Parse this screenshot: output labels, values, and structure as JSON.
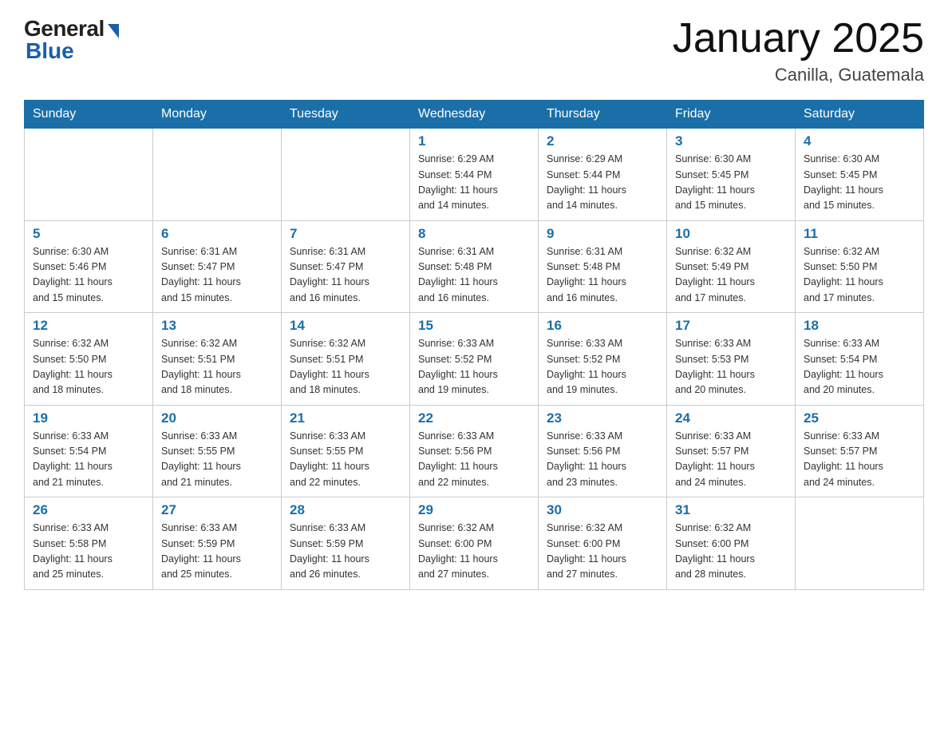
{
  "header": {
    "logo_general": "General",
    "logo_blue": "Blue",
    "month_title": "January 2025",
    "location": "Canilla, Guatemala"
  },
  "weekdays": [
    "Sunday",
    "Monday",
    "Tuesday",
    "Wednesday",
    "Thursday",
    "Friday",
    "Saturday"
  ],
  "weeks": [
    [
      {
        "day": "",
        "info": ""
      },
      {
        "day": "",
        "info": ""
      },
      {
        "day": "",
        "info": ""
      },
      {
        "day": "1",
        "info": "Sunrise: 6:29 AM\nSunset: 5:44 PM\nDaylight: 11 hours\nand 14 minutes."
      },
      {
        "day": "2",
        "info": "Sunrise: 6:29 AM\nSunset: 5:44 PM\nDaylight: 11 hours\nand 14 minutes."
      },
      {
        "day": "3",
        "info": "Sunrise: 6:30 AM\nSunset: 5:45 PM\nDaylight: 11 hours\nand 15 minutes."
      },
      {
        "day": "4",
        "info": "Sunrise: 6:30 AM\nSunset: 5:45 PM\nDaylight: 11 hours\nand 15 minutes."
      }
    ],
    [
      {
        "day": "5",
        "info": "Sunrise: 6:30 AM\nSunset: 5:46 PM\nDaylight: 11 hours\nand 15 minutes."
      },
      {
        "day": "6",
        "info": "Sunrise: 6:31 AM\nSunset: 5:47 PM\nDaylight: 11 hours\nand 15 minutes."
      },
      {
        "day": "7",
        "info": "Sunrise: 6:31 AM\nSunset: 5:47 PM\nDaylight: 11 hours\nand 16 minutes."
      },
      {
        "day": "8",
        "info": "Sunrise: 6:31 AM\nSunset: 5:48 PM\nDaylight: 11 hours\nand 16 minutes."
      },
      {
        "day": "9",
        "info": "Sunrise: 6:31 AM\nSunset: 5:48 PM\nDaylight: 11 hours\nand 16 minutes."
      },
      {
        "day": "10",
        "info": "Sunrise: 6:32 AM\nSunset: 5:49 PM\nDaylight: 11 hours\nand 17 minutes."
      },
      {
        "day": "11",
        "info": "Sunrise: 6:32 AM\nSunset: 5:50 PM\nDaylight: 11 hours\nand 17 minutes."
      }
    ],
    [
      {
        "day": "12",
        "info": "Sunrise: 6:32 AM\nSunset: 5:50 PM\nDaylight: 11 hours\nand 18 minutes."
      },
      {
        "day": "13",
        "info": "Sunrise: 6:32 AM\nSunset: 5:51 PM\nDaylight: 11 hours\nand 18 minutes."
      },
      {
        "day": "14",
        "info": "Sunrise: 6:32 AM\nSunset: 5:51 PM\nDaylight: 11 hours\nand 18 minutes."
      },
      {
        "day": "15",
        "info": "Sunrise: 6:33 AM\nSunset: 5:52 PM\nDaylight: 11 hours\nand 19 minutes."
      },
      {
        "day": "16",
        "info": "Sunrise: 6:33 AM\nSunset: 5:52 PM\nDaylight: 11 hours\nand 19 minutes."
      },
      {
        "day": "17",
        "info": "Sunrise: 6:33 AM\nSunset: 5:53 PM\nDaylight: 11 hours\nand 20 minutes."
      },
      {
        "day": "18",
        "info": "Sunrise: 6:33 AM\nSunset: 5:54 PM\nDaylight: 11 hours\nand 20 minutes."
      }
    ],
    [
      {
        "day": "19",
        "info": "Sunrise: 6:33 AM\nSunset: 5:54 PM\nDaylight: 11 hours\nand 21 minutes."
      },
      {
        "day": "20",
        "info": "Sunrise: 6:33 AM\nSunset: 5:55 PM\nDaylight: 11 hours\nand 21 minutes."
      },
      {
        "day": "21",
        "info": "Sunrise: 6:33 AM\nSunset: 5:55 PM\nDaylight: 11 hours\nand 22 minutes."
      },
      {
        "day": "22",
        "info": "Sunrise: 6:33 AM\nSunset: 5:56 PM\nDaylight: 11 hours\nand 22 minutes."
      },
      {
        "day": "23",
        "info": "Sunrise: 6:33 AM\nSunset: 5:56 PM\nDaylight: 11 hours\nand 23 minutes."
      },
      {
        "day": "24",
        "info": "Sunrise: 6:33 AM\nSunset: 5:57 PM\nDaylight: 11 hours\nand 24 minutes."
      },
      {
        "day": "25",
        "info": "Sunrise: 6:33 AM\nSunset: 5:57 PM\nDaylight: 11 hours\nand 24 minutes."
      }
    ],
    [
      {
        "day": "26",
        "info": "Sunrise: 6:33 AM\nSunset: 5:58 PM\nDaylight: 11 hours\nand 25 minutes."
      },
      {
        "day": "27",
        "info": "Sunrise: 6:33 AM\nSunset: 5:59 PM\nDaylight: 11 hours\nand 25 minutes."
      },
      {
        "day": "28",
        "info": "Sunrise: 6:33 AM\nSunset: 5:59 PM\nDaylight: 11 hours\nand 26 minutes."
      },
      {
        "day": "29",
        "info": "Sunrise: 6:32 AM\nSunset: 6:00 PM\nDaylight: 11 hours\nand 27 minutes."
      },
      {
        "day": "30",
        "info": "Sunrise: 6:32 AM\nSunset: 6:00 PM\nDaylight: 11 hours\nand 27 minutes."
      },
      {
        "day": "31",
        "info": "Sunrise: 6:32 AM\nSunset: 6:00 PM\nDaylight: 11 hours\nand 28 minutes."
      },
      {
        "day": "",
        "info": ""
      }
    ]
  ]
}
